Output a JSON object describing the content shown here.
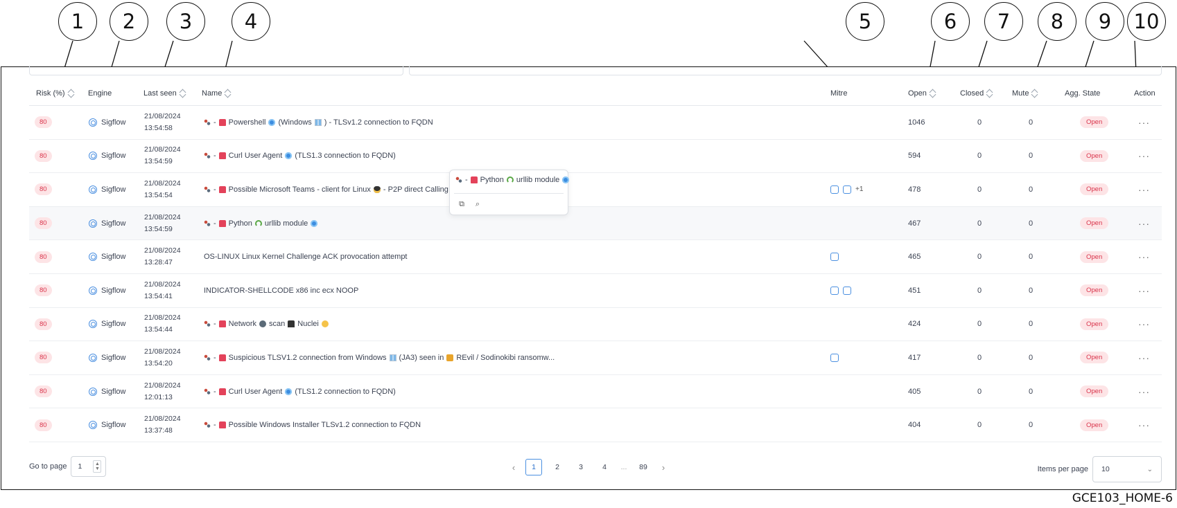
{
  "callouts": [
    "1",
    "2",
    "3",
    "4",
    "5",
    "6",
    "7",
    "8",
    "9",
    "10"
  ],
  "columns": {
    "risk": "Risk (%)",
    "engine": "Engine",
    "last_seen": "Last seen",
    "name": "Name",
    "mitre": "Mitre",
    "open": "Open",
    "closed": "Closed",
    "mute": "Mute",
    "agg_state": "Agg. State",
    "action": "Action"
  },
  "rows": [
    {
      "risk": "80",
      "engine": "Sigflow",
      "date": "21/08/2024",
      "time": "13:54:58",
      "name_parts": [
        "-",
        "Powershell",
        "(Windows",
        ") - TLSv1.2 connection to FQDN"
      ],
      "mitre_plus": "",
      "open": "1046",
      "closed": "0",
      "mute": "0",
      "state": "Open"
    },
    {
      "risk": "80",
      "engine": "Sigflow",
      "date": "21/08/2024",
      "time": "13:54:59",
      "name_parts": [
        "-",
        "Curl User Agent",
        "(TLS1.3 connection to FQDN)"
      ],
      "mitre_plus": "",
      "open": "594",
      "closed": "0",
      "mute": "0",
      "state": "Open"
    },
    {
      "risk": "80",
      "engine": "Sigflow",
      "date": "21/08/2024",
      "time": "13:54:54",
      "name_parts": [
        "-",
        "Possible Microsoft Teams - client for Linux",
        "- P2P direct Calling via"
      ],
      "mitre_plus": "+1",
      "open": "478",
      "closed": "0",
      "mute": "0",
      "state": "Open"
    },
    {
      "risk": "80",
      "engine": "Sigflow",
      "date": "21/08/2024",
      "time": "13:54:59",
      "name_parts": [
        "-",
        "Python",
        "urllib module"
      ],
      "mitre_plus": "",
      "open": "467",
      "closed": "0",
      "mute": "0",
      "state": "Open"
    },
    {
      "risk": "80",
      "engine": "Sigflow",
      "date": "21/08/2024",
      "time": "13:28:47",
      "name_parts": [
        "OS-LINUX Linux Kernel Challenge ACK provocation attempt"
      ],
      "mitre_plus": "",
      "open": "465",
      "closed": "0",
      "mute": "0",
      "state": "Open"
    },
    {
      "risk": "80",
      "engine": "Sigflow",
      "date": "21/08/2024",
      "time": "13:54:41",
      "name_parts": [
        "INDICATOR-SHELLCODE x86 inc ecx NOOP"
      ],
      "mitre_plus": "",
      "open": "451",
      "closed": "0",
      "mute": "0",
      "state": "Open"
    },
    {
      "risk": "80",
      "engine": "Sigflow",
      "date": "21/08/2024",
      "time": "13:54:44",
      "name_parts": [
        "-",
        "Network",
        "scan",
        "Nuclei"
      ],
      "mitre_plus": "",
      "open": "424",
      "closed": "0",
      "mute": "0",
      "state": "Open"
    },
    {
      "risk": "80",
      "engine": "Sigflow",
      "date": "21/08/2024",
      "time": "13:54:20",
      "name_parts": [
        "-",
        "Suspicious TLSV1.2 connection from Windows",
        "(JA3) seen in",
        "REvil / Sodinokibi ransomw..."
      ],
      "mitre_plus": "",
      "open": "417",
      "closed": "0",
      "mute": "0",
      "state": "Open"
    },
    {
      "risk": "80",
      "engine": "Sigflow",
      "date": "21/08/2024",
      "time": "12:01:13",
      "name_parts": [
        "-",
        "Curl User Agent",
        "(TLS1.2 connection to FQDN)"
      ],
      "mitre_plus": "",
      "open": "405",
      "closed": "0",
      "mute": "0",
      "state": "Open"
    },
    {
      "risk": "80",
      "engine": "Sigflow",
      "date": "21/08/2024",
      "time": "13:37:48",
      "name_parts": [
        "-",
        "Possible Windows Installer TLSv1.2 connection to FQDN"
      ],
      "mitre_plus": "",
      "open": "404",
      "closed": "0",
      "mute": "0",
      "state": "Open"
    }
  ],
  "tooltip": {
    "parts": [
      "-",
      "Python",
      "urllib module"
    ]
  },
  "footer": {
    "goto_label": "Go to page",
    "goto_value": "1",
    "pages": [
      "1",
      "2",
      "3",
      "4",
      "...",
      "89"
    ],
    "active_page": "1",
    "items_per_page_label": "Items per page",
    "items_per_page_value": "10"
  },
  "figure_code": "GCE103_HOME-6",
  "colors": {
    "accent": "#4a8fe0",
    "badge_bg": "#fde4e6",
    "badge_text": "#d9334a"
  }
}
